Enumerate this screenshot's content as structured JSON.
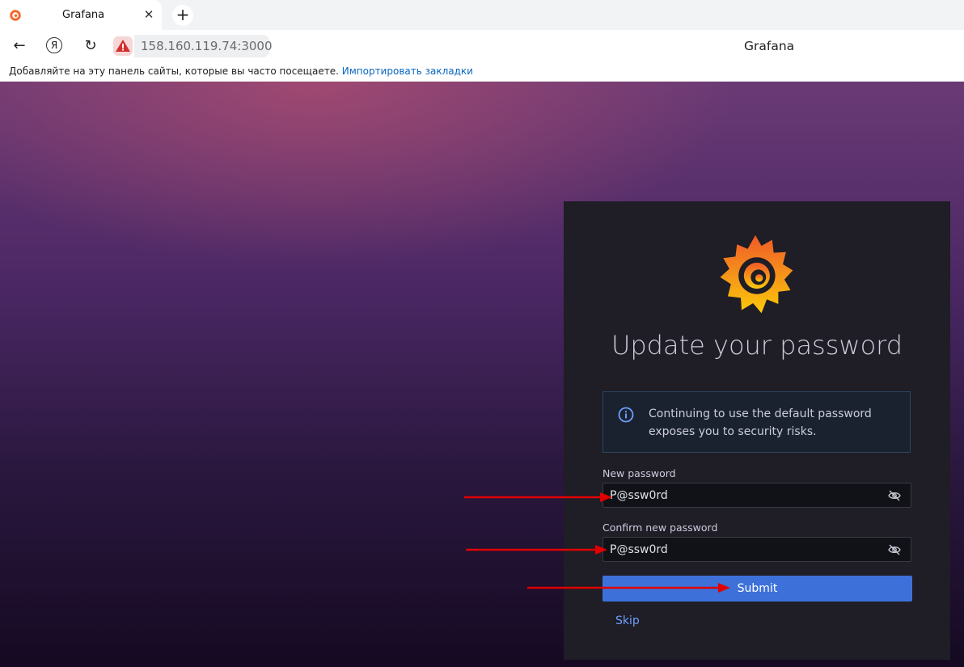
{
  "browser": {
    "tab": {
      "title": "Grafana",
      "close_glyph": "✕"
    },
    "new_tab_glyph": "+",
    "address": "158.160.119.74:3000",
    "page_title": "Grafana",
    "bookmarks": {
      "text": "Добавляйте на эту панель сайты, которые вы часто посещаете.",
      "link": "Импортировать закладки"
    },
    "icons": {
      "back": "←",
      "yandex": "Я",
      "reload": "↻"
    }
  },
  "login": {
    "heading": "Update your password",
    "alert_text": "Continuing to use the default password exposes you to security risks.",
    "new_password_label": "New password",
    "new_password_value": "P@ssw0rd",
    "confirm_password_label": "Confirm new password",
    "confirm_password_value": "P@ssw0rd",
    "submit_label": "Submit",
    "skip_label": "Skip"
  },
  "colors": {
    "accent": "#3d71d9",
    "annotation_arrow": "#e00000",
    "card_bg": "#1f1d26"
  }
}
